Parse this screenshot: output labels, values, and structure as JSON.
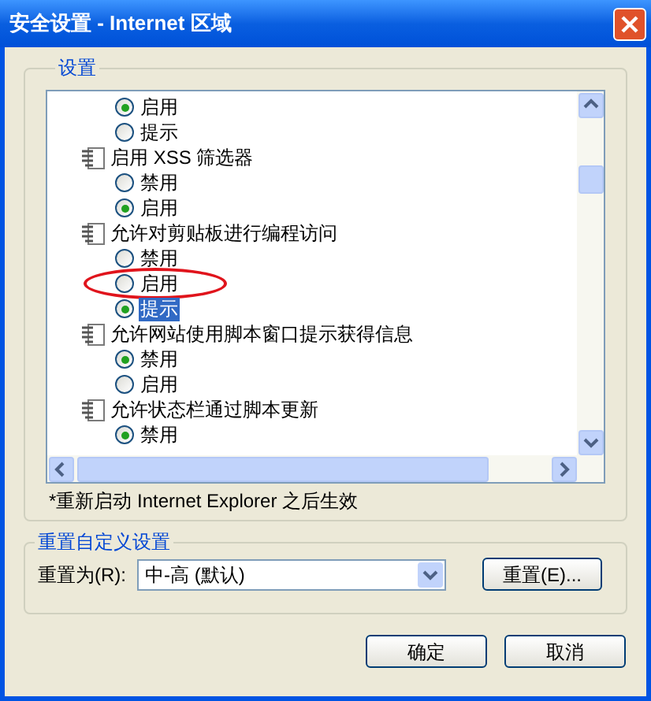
{
  "window": {
    "title": "安全设置 - Internet 区域"
  },
  "settings": {
    "legend": "设置",
    "items": [
      {
        "kind": "option",
        "label": "启用",
        "checked": true,
        "selected": false,
        "circled": false
      },
      {
        "kind": "option",
        "label": "提示",
        "checked": false,
        "selected": false,
        "circled": false
      },
      {
        "kind": "group",
        "label": "启用 XSS 筛选器"
      },
      {
        "kind": "option",
        "label": "禁用",
        "checked": false,
        "selected": false,
        "circled": false
      },
      {
        "kind": "option",
        "label": "启用",
        "checked": true,
        "selected": false,
        "circled": false
      },
      {
        "kind": "group",
        "label": "允许对剪贴板进行编程访问"
      },
      {
        "kind": "option",
        "label": "禁用",
        "checked": false,
        "selected": false,
        "circled": false
      },
      {
        "kind": "option",
        "label": "启用",
        "checked": false,
        "selected": false,
        "circled": true
      },
      {
        "kind": "option",
        "label": "提示",
        "checked": true,
        "selected": true,
        "circled": false
      },
      {
        "kind": "group",
        "label": "允许网站使用脚本窗口提示获得信息"
      },
      {
        "kind": "option",
        "label": "禁用",
        "checked": true,
        "selected": false,
        "circled": false
      },
      {
        "kind": "option",
        "label": "启用",
        "checked": false,
        "selected": false,
        "circled": false
      },
      {
        "kind": "group",
        "label": "允许状态栏通过脚本更新"
      },
      {
        "kind": "option",
        "label": "禁用",
        "checked": true,
        "selected": false,
        "circled": false
      }
    ],
    "note": "*重新启动 Internet Explorer 之后生效"
  },
  "reset": {
    "legend": "重置自定义设置",
    "label": "重置为(R):",
    "value": "中-高 (默认)",
    "button": "重置(E)..."
  },
  "buttons": [
    "确定",
    "取消"
  ]
}
